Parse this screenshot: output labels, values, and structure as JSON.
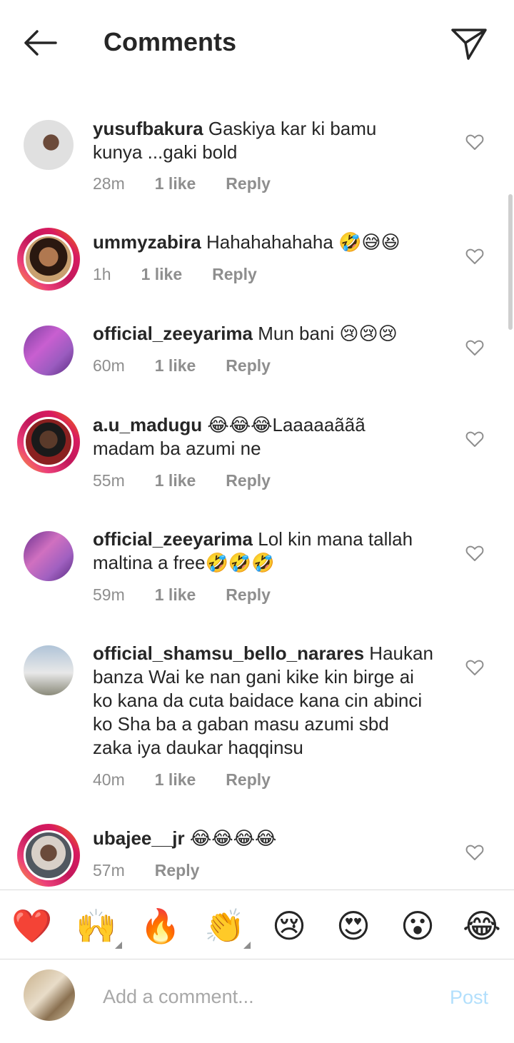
{
  "header": {
    "title": "Comments"
  },
  "comments": [
    {
      "username": "yusufbakura",
      "text_line1": "Gaskiya kar ki bamu",
      "text_line2": "kunya ...gaki bold",
      "time": "28m",
      "likes": "1 like",
      "reply": "Reply"
    },
    {
      "username": "ummyzabira",
      "text_line1": "Hahahahahaha 🤣😅😆",
      "time": "1h",
      "likes": "1 like",
      "reply": "Reply"
    },
    {
      "username": "official_zeeyarima",
      "text_line1": "Mun bani 😢😢😢",
      "time": "60m",
      "likes": "1 like",
      "reply": "Reply"
    },
    {
      "username": "a.u_madugu",
      "text_line1": "😂😂😂Laaaaaããã",
      "text_line2": "madam ba azumi ne",
      "time": "55m",
      "likes": "1 like",
      "reply": "Reply"
    },
    {
      "username": "official_zeeyarima",
      "text_line1": "Lol kin mana tallah",
      "text_line2": "maltina a free🤣🤣🤣",
      "time": "59m",
      "likes": "1 like",
      "reply": "Reply"
    },
    {
      "username": "official_shamsu_bello_narares",
      "text_line1": "Haukan",
      "text_line2": "banza Wai ke nan gani kike kin birge ai",
      "text_line3": "ko kana da cuta baidace kana cin abinci",
      "text_line4": "ko Sha ba a gaban masu azumi sbd",
      "text_line5": "zaka iya daukar haqqinsu",
      "time": "40m",
      "likes": "1 like",
      "reply": "Reply"
    },
    {
      "username": "ubajee__jr",
      "text_line1": "😂😂😂😂",
      "time": "57m",
      "reply": "Reply"
    }
  ],
  "reactions": [
    "❤️",
    "🙌",
    "🔥",
    "👏",
    "😢",
    "😍",
    "😮",
    "😂"
  ],
  "composer": {
    "placeholder": "Add a comment...",
    "post_label": "Post"
  },
  "colors": {
    "text": "#262626",
    "muted": "#8e8e8e",
    "post_disabled": "#b2dffc",
    "story_ring": "#ec407a"
  }
}
